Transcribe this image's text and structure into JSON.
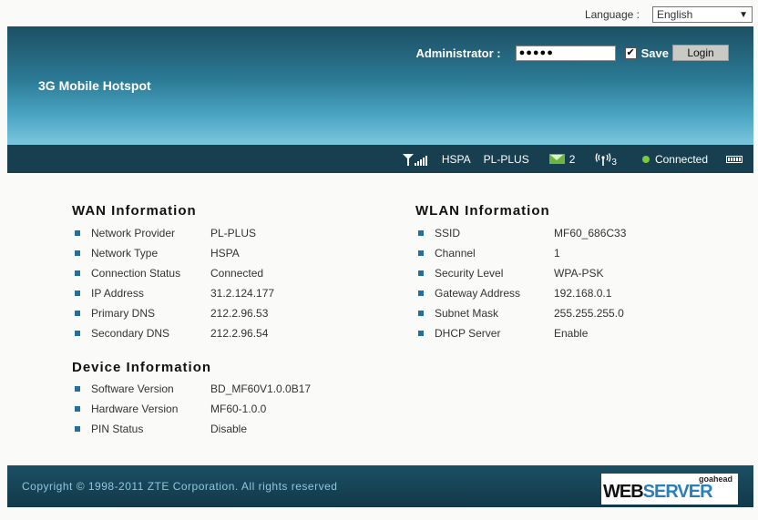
{
  "language": {
    "label": "Language :",
    "selected": "English"
  },
  "header": {
    "title": "3G Mobile Hotspot",
    "admin_label": "Administrator :",
    "password_value": "●●●●●",
    "save_checked": "✔",
    "save_label": "Save",
    "login_label": "Login"
  },
  "status": {
    "network_mode": "HSPA",
    "provider": "PL-PLUS",
    "sms_count": "2",
    "wifi_clients": "3",
    "connection": "Connected"
  },
  "wan": {
    "title": "WAN Information",
    "rows": [
      {
        "key": "Network Provider",
        "value": "PL-PLUS"
      },
      {
        "key": "Network Type",
        "value": "HSPA"
      },
      {
        "key": "Connection Status",
        "value": "Connected"
      },
      {
        "key": "IP Address",
        "value": "31.2.124.177"
      },
      {
        "key": "Primary DNS",
        "value": "212.2.96.53"
      },
      {
        "key": "Secondary DNS",
        "value": "212.2.96.54"
      }
    ]
  },
  "device": {
    "title": "Device Information",
    "rows": [
      {
        "key": "Software Version",
        "value": "BD_MF60V1.0.0B17"
      },
      {
        "key": "Hardware Version",
        "value": "MF60-1.0.0"
      },
      {
        "key": "PIN Status",
        "value": "Disable"
      }
    ]
  },
  "wlan": {
    "title": "WLAN Information",
    "rows": [
      {
        "key": "SSID",
        "value": "MF60_686C33"
      },
      {
        "key": "Channel",
        "value": "1"
      },
      {
        "key": "Security Level",
        "value": "WPA-PSK"
      },
      {
        "key": "Gateway Address",
        "value": "192.168.0.1"
      },
      {
        "key": "Subnet Mask",
        "value": "255.255.255.0"
      },
      {
        "key": "DHCP Server",
        "value": "Enable"
      }
    ]
  },
  "footer": {
    "copyright": "Copyright © 1998-2011 ZTE Corporation. All rights reserved",
    "logo_small": "goahead",
    "logo_web": "WEB",
    "logo_server": "SERVER"
  },
  "colors": {
    "banner_dark": "#1d4f63",
    "banner_light": "#7cc5de",
    "status_bar": "#173f4f",
    "bullet": "#1f6f9f",
    "connected": "#7ac943"
  }
}
